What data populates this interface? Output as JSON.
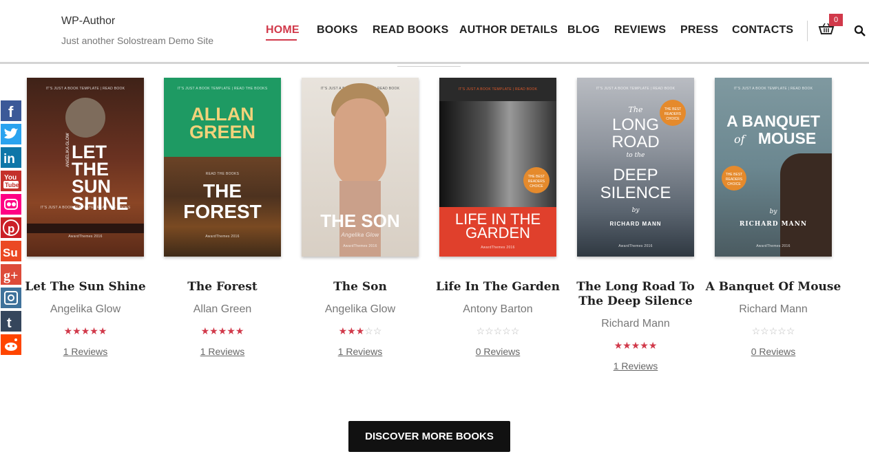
{
  "site": {
    "title": "WP-Author",
    "description": "Just another Solostream Demo Site"
  },
  "nav": {
    "items": [
      {
        "label": "HOME",
        "active": true
      },
      {
        "label": "BOOKS",
        "active": false
      },
      {
        "label": "READ BOOKS",
        "active": false
      },
      {
        "label": "AUTHOR DETAILS",
        "active": false
      },
      {
        "label": "BLOG",
        "active": false
      },
      {
        "label": "REVIEWS",
        "active": false
      },
      {
        "label": "PRESS",
        "active": false
      },
      {
        "label": "CONTACTS",
        "active": false
      }
    ],
    "cart_count": "0",
    "icons": [
      "cart-icon",
      "search-icon"
    ]
  },
  "social": [
    "facebook-icon",
    "twitter-icon",
    "linkedin-icon",
    "youtube-icon",
    "flickr-icon",
    "pinterest-icon",
    "stumbleupon-icon",
    "google-plus-icon",
    "instagram-icon",
    "tumblr-icon",
    "reddit-icon"
  ],
  "books": [
    {
      "title": "Let The Sun Shine",
      "author": "Angelika Glow",
      "rating": 5,
      "reviews": "1 Reviews",
      "cover": {
        "top_text": "IT'S JUST A BOOK TEMPLATE  |  READ BOOK",
        "main_text": "LET THE SUN SHINE",
        "side_text": "ANGELIKA GLOW",
        "tagline": "IT'S JUST A BOOK TEMPLATE  |  READ THE BOOKS",
        "footer": "AwardThemes 2016"
      }
    },
    {
      "title": "The Forest",
      "author": "Allan Green",
      "rating": 5,
      "reviews": "1 Reviews",
      "cover": {
        "top_text": "IT'S JUST A BOOK TEMPLATE  |  READ THE BOOKS",
        "author_text": "ALLAN GREEN",
        "small_label": "READ THE BOOKS",
        "main_text": "THE FOREST",
        "footer": "AwardThemes 2016"
      }
    },
    {
      "title": "The Son",
      "author": "Angelika Glow",
      "rating": 3,
      "reviews": "1 Reviews",
      "cover": {
        "top_text": "IT'S JUST A BOOK TEMPLATE  |  READ BOOK",
        "main_text": "THE SON",
        "author_text": "Angelika Glow",
        "footer": "AwardThemes 2016"
      }
    },
    {
      "title": "Life In The Garden",
      "author": "Antony Barton",
      "rating": 0,
      "reviews": "0 Reviews",
      "cover": {
        "top_text": "IT'S JUST A BOOK TEMPLATE  |  READ BOOK",
        "badge": "THE BEST READERS CHOICE",
        "main_text": "LIFE IN THE GARDEN",
        "footer": "AwardThemes 2016"
      }
    },
    {
      "title": "The Long Road To The Deep Silence",
      "author": "Richard Mann",
      "rating": 5,
      "reviews": "1 Reviews",
      "cover": {
        "top_text": "IT'S JUST A BOOK TEMPLATE  |  READ BOOK",
        "line1": "The",
        "line2": "LONG",
        "line3": "ROAD",
        "line4": "to the",
        "line5": "DEEP",
        "line6": "SILENCE",
        "by": "by",
        "author_text": "RICHARD MANN",
        "badge": "THE BEST READERS CHOICE",
        "footer": "AwardThemes 2016"
      }
    },
    {
      "title": "A Banquet Of Mouse",
      "author": "Richard Mann",
      "rating": 0,
      "reviews": "0 Reviews",
      "cover": {
        "top_text": "IT'S JUST A BOOK TEMPLATE  |  READ BOOK",
        "line1": "A BANQUET",
        "line2": "of",
        "line3": "MOUSE",
        "by": "by",
        "author_text": "RICHARD MANN",
        "badge": "THE BEST READERS CHOICE",
        "footer": "AwardThemes 2016"
      }
    }
  ],
  "cta": {
    "label": "DISCOVER MORE BOOKS"
  },
  "colors": {
    "accent": "#d1394a",
    "button_bg": "#111111"
  }
}
